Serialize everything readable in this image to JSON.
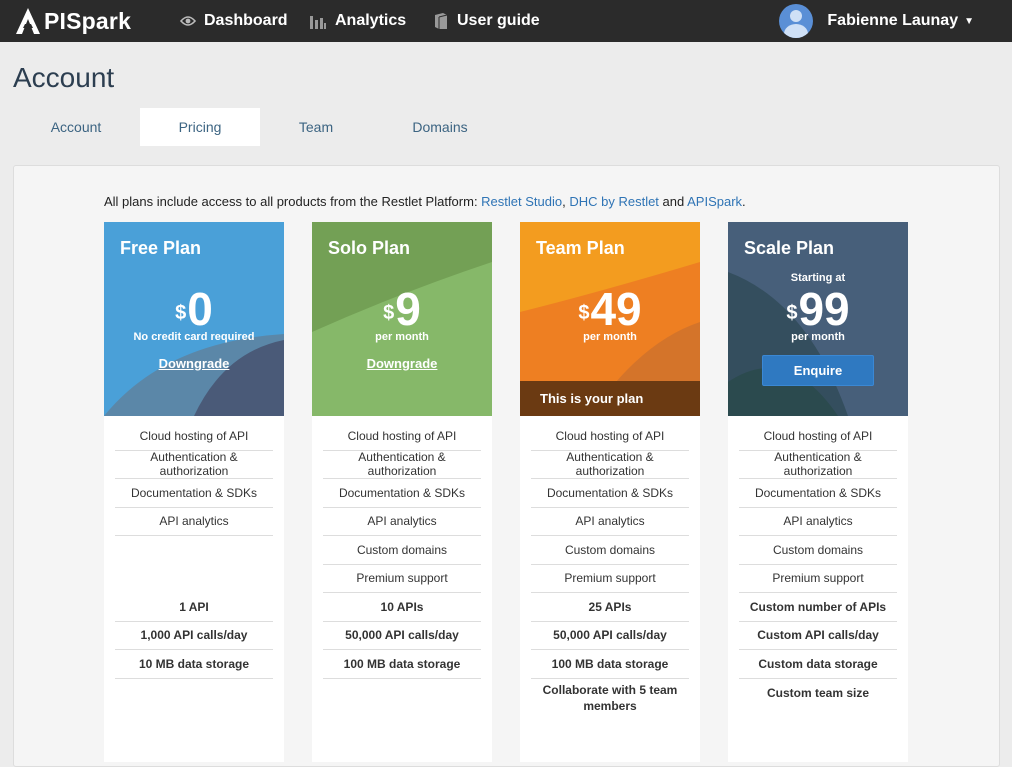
{
  "nav": {
    "logo_text": "PISpark",
    "items": [
      {
        "label": "Dashboard",
        "icon": "eye-icon"
      },
      {
        "label": "Analytics",
        "icon": "bar-chart-icon"
      },
      {
        "label": "User guide",
        "icon": "book-icon"
      }
    ],
    "user_name": "Fabienne Launay"
  },
  "page": {
    "title": "Account",
    "tabs": [
      "Account",
      "Pricing",
      "Team",
      "Domains"
    ],
    "active_tab": "Pricing"
  },
  "intro": {
    "text": "All plans include access to all products from the Restlet Platform: ",
    "links": [
      "Restlet Studio",
      "DHC by Restlet",
      "APISpark"
    ],
    "sep1": ", ",
    "sep2": " and ",
    "end": "."
  },
  "plans": [
    {
      "name": "Free Plan",
      "currency": "$",
      "amount": "0",
      "subtitle": "No credit card required",
      "action": "Downgrade",
      "color": "#4aa0d8",
      "features": [
        "Cloud hosting of API",
        "Authentication & authorization",
        "Documentation & SDKs",
        "API analytics",
        "",
        "",
        "1 API",
        "1,000 API calls/day",
        "10 MB data storage"
      ]
    },
    {
      "name": "Solo Plan",
      "currency": "$",
      "amount": "9",
      "subtitle": "per month",
      "action": "Downgrade",
      "color": "#86b869",
      "features": [
        "Cloud hosting of API",
        "Authentication & authorization",
        "Documentation & SDKs",
        "API analytics",
        "Custom domains",
        "Premium support",
        "10 APIs",
        "50,000 API calls/day",
        "100 MB data storage"
      ]
    },
    {
      "name": "Team Plan",
      "currency": "$",
      "amount": "49",
      "subtitle": "per month",
      "badge": "This is your plan",
      "color": "#f39c1f",
      "features": [
        "Cloud hosting of API",
        "Authentication & authorization",
        "Documentation & SDKs",
        "API analytics",
        "Custom domains",
        "Premium support",
        "25 APIs",
        "50,000 API calls/day",
        "100 MB data storage",
        "Collaborate with 5 team members"
      ]
    },
    {
      "name": "Scale Plan",
      "prefix": "Starting at",
      "currency": "$",
      "amount": "99",
      "subtitle": "per month",
      "action": "Enquire",
      "color": "#344e5e",
      "features": [
        "Cloud hosting of API",
        "Authentication & authorization",
        "Documentation & SDKs",
        "API analytics",
        "Custom domains",
        "Premium support",
        "Custom number of APIs",
        "Custom API calls/day",
        "Custom data storage",
        "Custom team size"
      ]
    }
  ]
}
